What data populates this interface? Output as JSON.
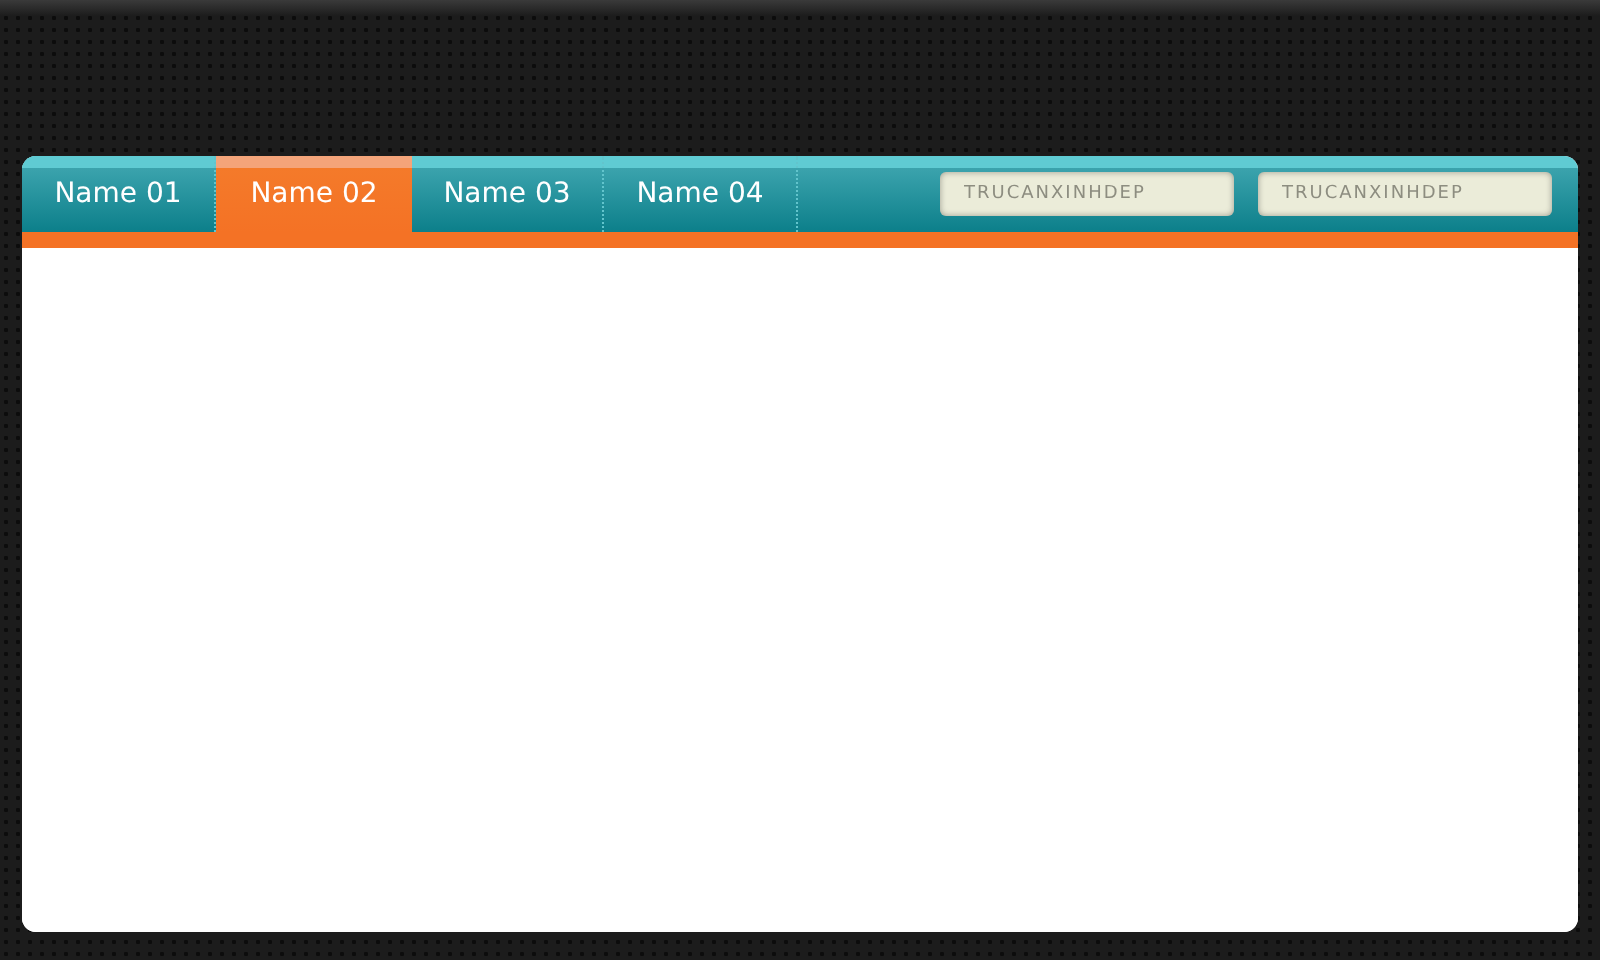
{
  "tabs": [
    {
      "label": "Name 01",
      "selected": false
    },
    {
      "label": "Name 02",
      "selected": true
    },
    {
      "label": "Name 03",
      "selected": false
    },
    {
      "label": "Name 04",
      "selected": false
    }
  ],
  "fields": [
    {
      "placeholder": "TRUCANXINHDEP"
    },
    {
      "placeholder": "TRUCANXINHDEP"
    }
  ]
}
